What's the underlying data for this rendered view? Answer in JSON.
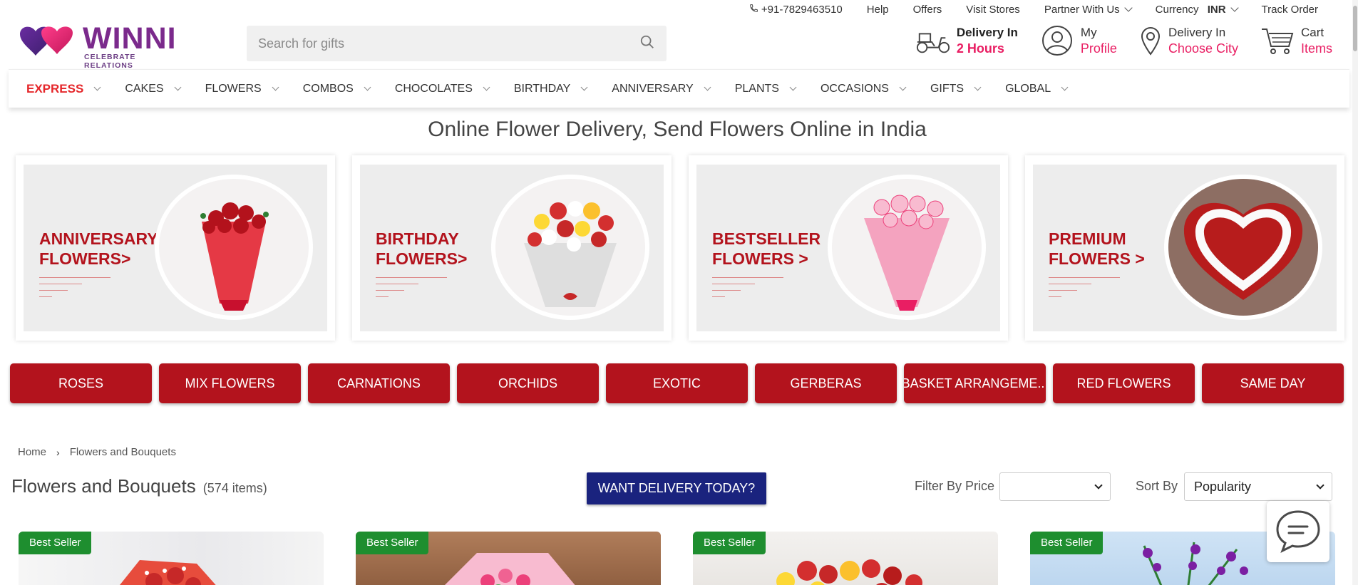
{
  "topbar": {
    "phone": "+91-7829463510",
    "help": "Help",
    "offers": "Offers",
    "visit_stores": "Visit Stores",
    "partner": "Partner With Us",
    "currency_label": "Currency",
    "currency_value": "INR",
    "track_order": "Track Order"
  },
  "logo": {
    "brand": "WINNI",
    "tagline": "CELEBRATE RELATIONS"
  },
  "search": {
    "placeholder": "Search for gifts"
  },
  "header_links": {
    "delivery_time": {
      "line1": "Delivery In",
      "line2": "2 Hours"
    },
    "profile": {
      "line1": "My",
      "line2": "Profile"
    },
    "city": {
      "line1": "Delivery In",
      "line2": "Choose City"
    },
    "cart": {
      "line1": "Cart",
      "line2": "Items"
    }
  },
  "nav": [
    "EXPRESS",
    "CAKES",
    "FLOWERS",
    "COMBOS",
    "CHOCOLATES",
    "BIRTHDAY",
    "ANNIVERSARY",
    "PLANTS",
    "OCCASIONS",
    "GIFTS",
    "GLOBAL"
  ],
  "page_title": "Online Flower Delivery, Send Flowers Online in India",
  "category_cards": [
    {
      "title_line1": "ANNIVERSARY",
      "title_line2": "FLOWERS>"
    },
    {
      "title_line1": "BIRTHDAY",
      "title_line2": "FLOWERS>"
    },
    {
      "title_line1": "BESTSELLER",
      "title_line2": "FLOWERS >"
    },
    {
      "title_line1": "PREMIUM",
      "title_line2": "FLOWERS >"
    }
  ],
  "pills": [
    "ROSES",
    "MIX FLOWERS",
    "CARNATIONS",
    "ORCHIDS",
    "EXOTIC",
    "GERBERAS",
    "BASKET ARRANGEME...",
    "RED FLOWERS",
    "SAME DAY"
  ],
  "breadcrumb": {
    "home": "Home",
    "current": "Flowers and Bouquets"
  },
  "listing": {
    "title": "Flowers and Bouquets",
    "count": "(574 items)",
    "want_delivery": "WANT DELIVERY TODAY?",
    "filter_label": "Filter By Price",
    "filter_value": "",
    "sort_label": "Sort By",
    "sort_value": "Popularity"
  },
  "products": [
    {
      "badge": "Best Seller"
    },
    {
      "badge": "Best Seller"
    },
    {
      "badge": "Best Seller"
    },
    {
      "badge": "Best Seller"
    }
  ],
  "colors": {
    "brand_red": "#b3131d",
    "accent_pink": "#e91e63",
    "navy": "#1a237e",
    "badge_green": "#1e8e2f"
  }
}
